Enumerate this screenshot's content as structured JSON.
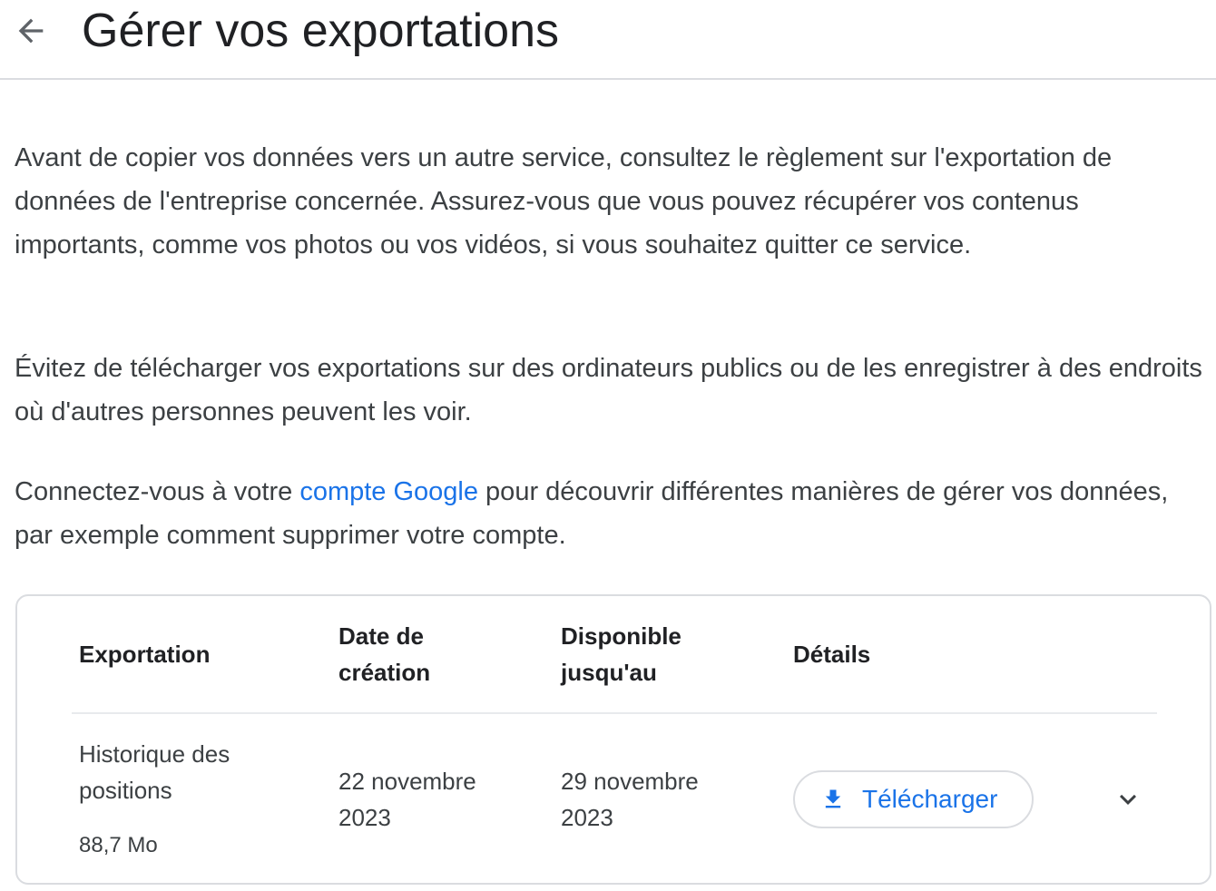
{
  "header": {
    "title": "Gérer vos exportations",
    "back_icon": "arrow-back-icon"
  },
  "intro": {
    "paragraph1": "Avant de copier vos données vers un autre service, consultez le règlement sur l'exportation de données de l'entreprise concernée. Assurez-vous que vous pouvez récupérer vos contenus importants, comme vos photos ou vos vidéos, si vous souhaitez quitter ce service.",
    "paragraph2": "Évitez de télécharger vos exportations sur des ordinateurs publics ou de les enregistrer à des endroits où d'autres personnes peuvent les voir.",
    "paragraph3_before": "Connectez-vous à votre ",
    "paragraph3_link": "compte Google",
    "paragraph3_after": " pour découvrir différentes manières de gérer vos données, par exemple comment supprimer votre compte."
  },
  "table": {
    "headers": {
      "export": "Exportation",
      "created_line1": "Date de",
      "created_line2": "création",
      "available_line1": "Disponible",
      "available_line2": "jusqu'au",
      "details": "Détails"
    },
    "rows": [
      {
        "name_line1": "Historique des",
        "name_line2": "positions",
        "size": "88,7 Mo",
        "created_line1": "22 novembre",
        "created_line2": "2023",
        "available_line1": "29 novembre",
        "available_line2": "2023",
        "download_label": "Télécharger",
        "download_icon": "download-icon",
        "expand_icon": "chevron-down-icon"
      }
    ]
  },
  "colors": {
    "link": "#1a73e8",
    "text": "#3c4043",
    "heading": "#202124",
    "border": "#dadce0"
  }
}
